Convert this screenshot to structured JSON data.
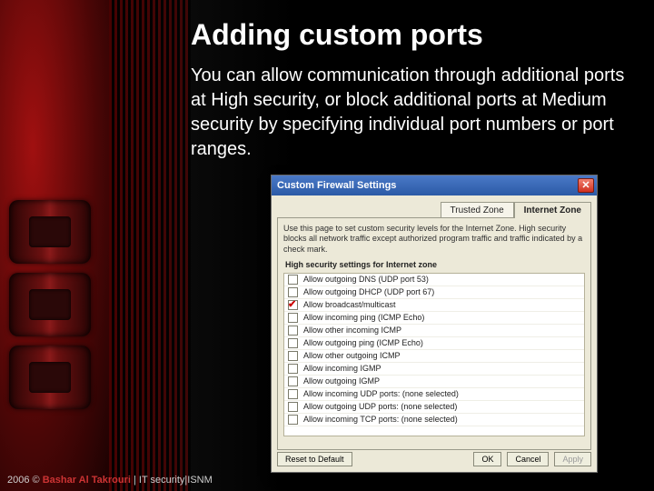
{
  "slide": {
    "title": "Adding custom ports",
    "body": "You can allow communication through additional ports at High security, or block additional ports at Medium security by specifying individual port numbers or port ranges."
  },
  "footer": {
    "year": "2006 ©",
    "author": "Bashar Al Takrouri",
    "sep": "|",
    "org": "IT security|ISNM"
  },
  "dialog": {
    "title": "Custom Firewall Settings",
    "close_glyph": "✕",
    "tabs": {
      "trusted": "Trusted Zone",
      "internet": "Internet Zone"
    },
    "description": "Use this page to set custom security levels for the Internet Zone. High security blocks all network traffic except authorized program traffic and traffic indicated by a check mark.",
    "group_label": "High security settings for Internet zone",
    "items": [
      {
        "label": "Allow outgoing DNS (UDP port 53)",
        "checked": false
      },
      {
        "label": "Allow outgoing DHCP (UDP port 67)",
        "checked": false
      },
      {
        "label": "Allow broadcast/multicast",
        "checked": true
      },
      {
        "label": "Allow incoming ping (ICMP Echo)",
        "checked": false
      },
      {
        "label": "Allow other incoming ICMP",
        "checked": false
      },
      {
        "label": "Allow outgoing ping (ICMP Echo)",
        "checked": false
      },
      {
        "label": "Allow other outgoing ICMP",
        "checked": false
      },
      {
        "label": "Allow incoming IGMP",
        "checked": false
      },
      {
        "label": "Allow outgoing IGMP",
        "checked": false
      },
      {
        "label": "Allow incoming UDP ports: (none selected)",
        "checked": false
      },
      {
        "label": "Allow outgoing UDP ports: (none selected)",
        "checked": false
      },
      {
        "label": "Allow incoming TCP ports: (none selected)",
        "checked": false
      }
    ],
    "buttons": {
      "reset": "Reset to Default",
      "ok": "OK",
      "cancel": "Cancel",
      "apply": "Apply"
    }
  }
}
